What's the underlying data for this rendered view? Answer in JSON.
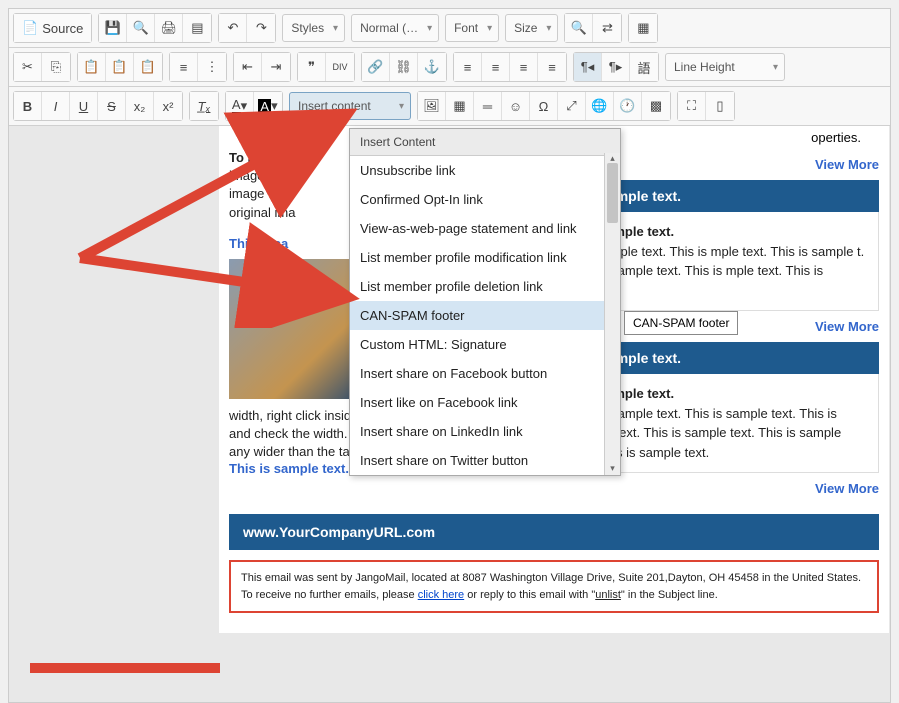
{
  "toolbar": {
    "source": "Source",
    "styles": "Styles",
    "format": "Normal (…",
    "font": "Font",
    "size": "Size",
    "line_height": "Line Height",
    "insert_content": "Insert content"
  },
  "dropdown": {
    "header": "Insert Content",
    "items": [
      "Unsubscribe link",
      "Confirmed Opt-In link",
      "View-as-web-page statement and link",
      "List member profile modification link",
      "List member profile deletion link",
      "CAN-SPAM footer",
      "Custom HTML: Signature",
      "Insert share on Facebook button",
      "Insert like on Facebook link",
      "Insert share on LinkedIn link",
      "Insert share on Twitter button"
    ],
    "hovered_index": 5
  },
  "tooltip": "CAN-SPAM footer",
  "content": {
    "replace_intro": "To replace",
    "replace_body": "image that \nimage that \noriginal ima",
    "sample1": "This is sa",
    "sample_full": "This is sample text.",
    "view_more": "View More",
    "section_header": "is is sample text.",
    "section_title": "is is sample text.",
    "section_body": "is is sample text. This is mple text. This is sample t. This is sample text. This is mple text. This is sample",
    "col_instructions": "width, right click inside the table. Go to Table properties and check the width. Make sure your image width is not any wider than the table cell width.",
    "section2_body": "This is sample text. This is sample text. This is sample text. This is sample text. This is sample text. This is sample text.",
    "properties_tail": "operties."
  },
  "footer": {
    "url": "www.YourCompanyURL.com",
    "canspam_1": "This email was sent by JangoMail, located at 8087 Washington Village Drive, Suite 201,Dayton, OH 45458 in the United States. To receive no further emails, please ",
    "canspam_link": "click here",
    "canspam_2": " or reply to this email with \"",
    "canspam_unlist": "unlist",
    "canspam_3": "\" in the Subject line."
  }
}
